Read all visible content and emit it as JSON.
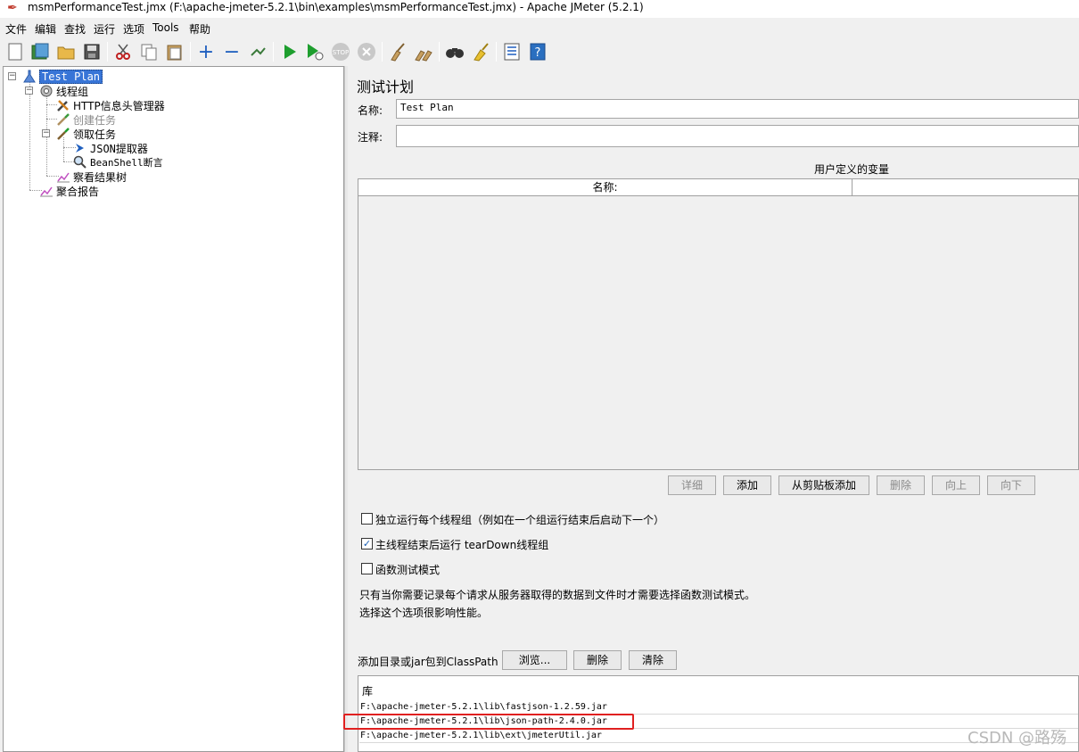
{
  "window": {
    "title": "msmPerformanceTest.jmx (F:\\apache-jmeter-5.2.1\\bin\\examples\\msmPerformanceTest.jmx) - Apache JMeter (5.2.1)"
  },
  "menubar": {
    "items": [
      "文件",
      "编辑",
      "查找",
      "运行",
      "选项",
      "Tools",
      "帮助"
    ]
  },
  "tree": {
    "nodes": [
      {
        "label": "Test Plan",
        "icon": "test-plan-icon"
      },
      {
        "label": "线程组",
        "icon": "gear-icon"
      },
      {
        "label": "HTTP信息头管理器",
        "icon": "wrench-icon"
      },
      {
        "label": "创建任务",
        "icon": "dropper-icon"
      },
      {
        "label": "领取任务",
        "icon": "dropper-icon"
      },
      {
        "label": "JSON提取器",
        "icon": "arrow-icon"
      },
      {
        "label": "BeanShell断言",
        "icon": "magnifier-icon"
      },
      {
        "label": "察看结果树",
        "icon": "graph-icon"
      },
      {
        "label": "聚合报告",
        "icon": "graph-icon"
      }
    ]
  },
  "panel": {
    "title": "测试计划",
    "name_label": "名称:",
    "name_value": "Test Plan",
    "comment_label": "注释:",
    "comment_value": "",
    "vars_title": "用户定义的变量",
    "vars_col_name": "名称:",
    "buttons": {
      "detail": "详细",
      "add": "添加",
      "add_clipboard": "从剪贴板添加",
      "delete": "删除",
      "up": "向上",
      "down": "向下"
    },
    "checkboxes": [
      {
        "label": "独立运行每个线程组（例如在一个组运行结束后启动下一个）",
        "checked": false
      },
      {
        "label": "主线程结束后运行 tearDown线程组",
        "checked": true
      },
      {
        "label": "函数测试模式",
        "checked": false
      }
    ],
    "note_line1": "只有当你需要记录每个请求从服务器取得的数据到文件时才需要选择函数测试模式。",
    "note_line2": "选择这个选项很影响性能。",
    "classpath_label": "添加目录或jar包到ClassPath",
    "classpath_buttons": {
      "browse": "浏览...",
      "delete": "删除",
      "clear": "清除"
    },
    "lib_header": "库",
    "libs": [
      "F:\\apache-jmeter-5.2.1\\lib\\fastjson-1.2.59.jar",
      "F:\\apache-jmeter-5.2.1\\lib\\json-path-2.4.0.jar",
      "F:\\apache-jmeter-5.2.1\\lib\\ext\\jmeterUtil.jar"
    ]
  },
  "watermark": "CSDN @路殇",
  "colors": {
    "selection": "#3875d7",
    "highlight": "#e02020",
    "run_green": "#1e9e2e"
  }
}
